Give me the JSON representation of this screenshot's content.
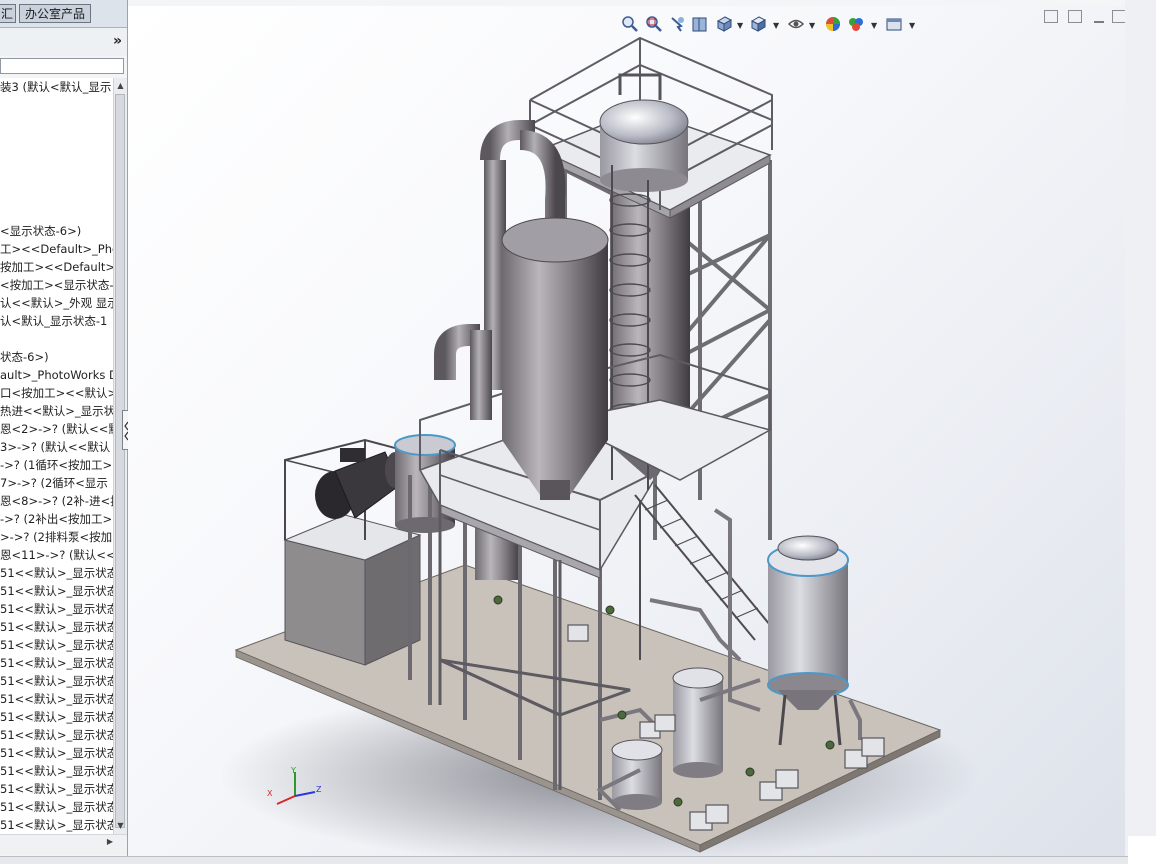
{
  "tabs": {
    "prev": "汇",
    "office": "办公室产品"
  },
  "panel": {
    "expand_glyph": "»"
  },
  "tree_rows": [
    "装3 (默认<默认_显示",
    "",
    "",
    "",
    "",
    "",
    "",
    "",
    "<显示状态-6>)",
    "工><<Default>_Pho",
    "按加工><<Default>",
    "<按加工><显示状态-",
    "认<<默认>_外观 显示",
    "认<默认_显示状态-1",
    "",
    "状态-6>)",
    "ault>_PhotoWorks D",
    "口<按加工><<默认>",
    "热进<<默认>_显示状",
    "恩<2>->? (默认<<默",
    "3>->? (默认<<默认",
    "->? (1循环<按加工>",
    "7>->? (2循环<显示",
    "恩<8>->? (2补-进<按",
    "->? (2补出<按加工>",
    ">->? (2排料泵<按加",
    "恩<11>->? (默认<<",
    "51<<默认>_显示状态",
    "51<<默认>_显示状态",
    "51<<默认>_显示状态",
    "51<<默认>_显示状态",
    "51<<默认>_显示状态",
    "51<<默认>_显示状态",
    "51<<默认>_显示状态",
    "51<<默认>_显示状态",
    "51<<默认>_显示状态",
    "51<<默认>_显示状态",
    "51<<默认>_显示状态",
    "51<<默认>_显示状态",
    "51<<默认>_显示状态",
    "51<<默认>_显示状态",
    "51<<默认>_显示状态"
  ],
  "hud": {
    "icons": [
      "zoom-to-fit-icon",
      "zoom-to-area-icon",
      "previous-view-icon",
      "section-view-icon",
      "view-orientation-icon",
      "display-style-icon",
      "hide-show-items-icon",
      "edit-appearance-icon",
      "apply-scene-icon",
      "view-settings-icon"
    ]
  },
  "triad": {
    "x_label": "X",
    "y_label": "Y",
    "z_label": "Z"
  },
  "colors": {
    "steel": "#8c8a8f",
    "platform": "#e4e6ea",
    "floor": "#c9c2bb",
    "axis_x": "#d42a2a",
    "axis_y": "#2a9a2a",
    "axis_z": "#2a3ad4"
  }
}
